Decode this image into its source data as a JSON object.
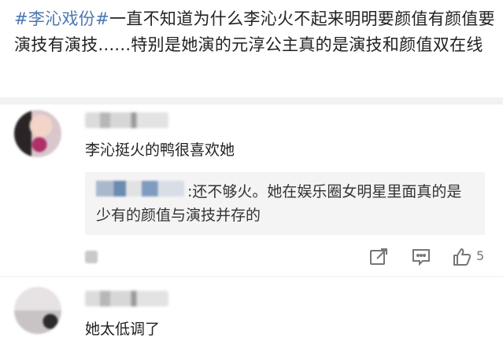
{
  "post": {
    "hashtag": "#李沁戏份#",
    "text": "一直不知道为什么李沁火不起来明明要颜值有颜值要演技有演技......特别是她演的元淳公主真的是演技和颜值双在线"
  },
  "comments": [
    {
      "text": "李沁挺火的鸭很喜欢她",
      "reply": {
        "colon": ":",
        "text": "还不够火。她在娱乐圈女明星里面真的是少有的颜值与演技并存的"
      },
      "actions": {
        "share_icon": "share-icon",
        "comment_icon": "comment-icon",
        "like_icon": "thumbs-up-icon",
        "like_count": "5"
      }
    },
    {
      "text": "她太低调了"
    }
  ],
  "colors": {
    "hashtag": "#4a78b0",
    "text": "#222222",
    "reply_bg": "#f4f4f4",
    "icon": "#777777"
  }
}
